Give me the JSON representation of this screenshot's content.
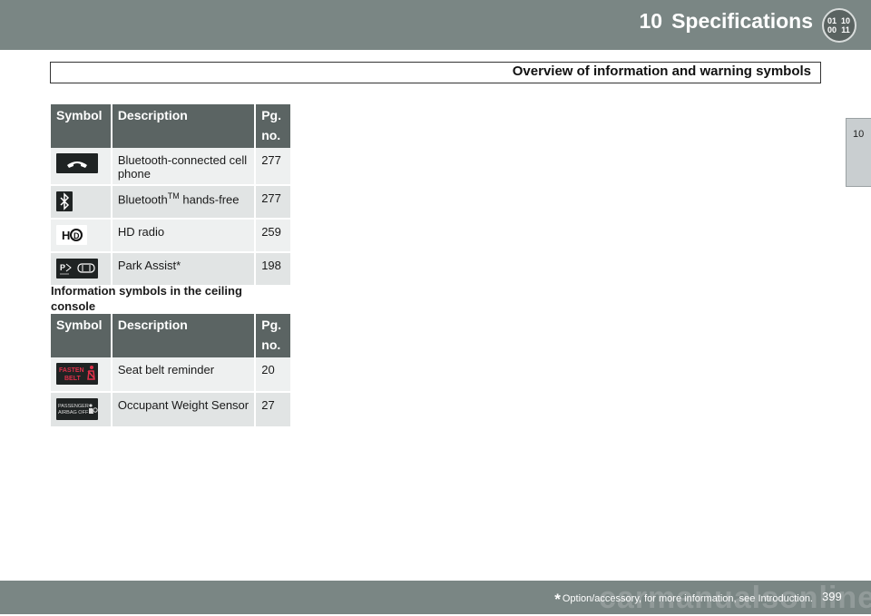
{
  "header": {
    "chapter_number": "10",
    "chapter_title": "Specifications",
    "chapter_icon_digits": [
      "01",
      "10",
      "00",
      "11"
    ],
    "section_title": "Overview of information and warning symbols"
  },
  "side_tab": {
    "label": "10"
  },
  "table1": {
    "columns": {
      "symbol": "Symbol",
      "description": "Description",
      "page_line1": "Pg.",
      "page_line2": "no."
    },
    "rows": [
      {
        "icon": "phone-icon",
        "description": "Bluetooth-connected cell phone",
        "page": "277"
      },
      {
        "icon": "bluetooth-icon",
        "description_pre": "Bluetooth",
        "description_sup": "TM",
        "description_post": " hands-free",
        "page": "277"
      },
      {
        "icon": "hd-radio-icon",
        "description": "HD radio",
        "page": "259"
      },
      {
        "icon": "park-assist-icon",
        "description": "Park Assist*",
        "page": "198"
      }
    ]
  },
  "subheading": "Information symbols in the ceiling console",
  "table2": {
    "columns": {
      "symbol": "Symbol",
      "description": "Description",
      "page_line1": "Pg.",
      "page_line2": "no."
    },
    "rows": [
      {
        "icon": "fasten-belt-icon",
        "icon_text": [
          "FASTEN",
          "BELT"
        ],
        "description": "Seat belt reminder",
        "page": "20"
      },
      {
        "icon": "passenger-airbag-off-icon",
        "icon_text": [
          "PASSENGER",
          "AIRBAG  OFF"
        ],
        "description": "Occupant Weight Sensor",
        "page": "27"
      }
    ]
  },
  "footer": {
    "star": "*",
    "footnote": "Option/accessory, for more information, see Introduction.",
    "page_number": "399",
    "watermark": "carmanualsonline.info"
  },
  "colors": {
    "band": "#7a8684",
    "table_header": "#5b6463",
    "row_light": "#eef0f0",
    "row_dark": "#e1e4e4",
    "belt_red": "#e0304a"
  }
}
